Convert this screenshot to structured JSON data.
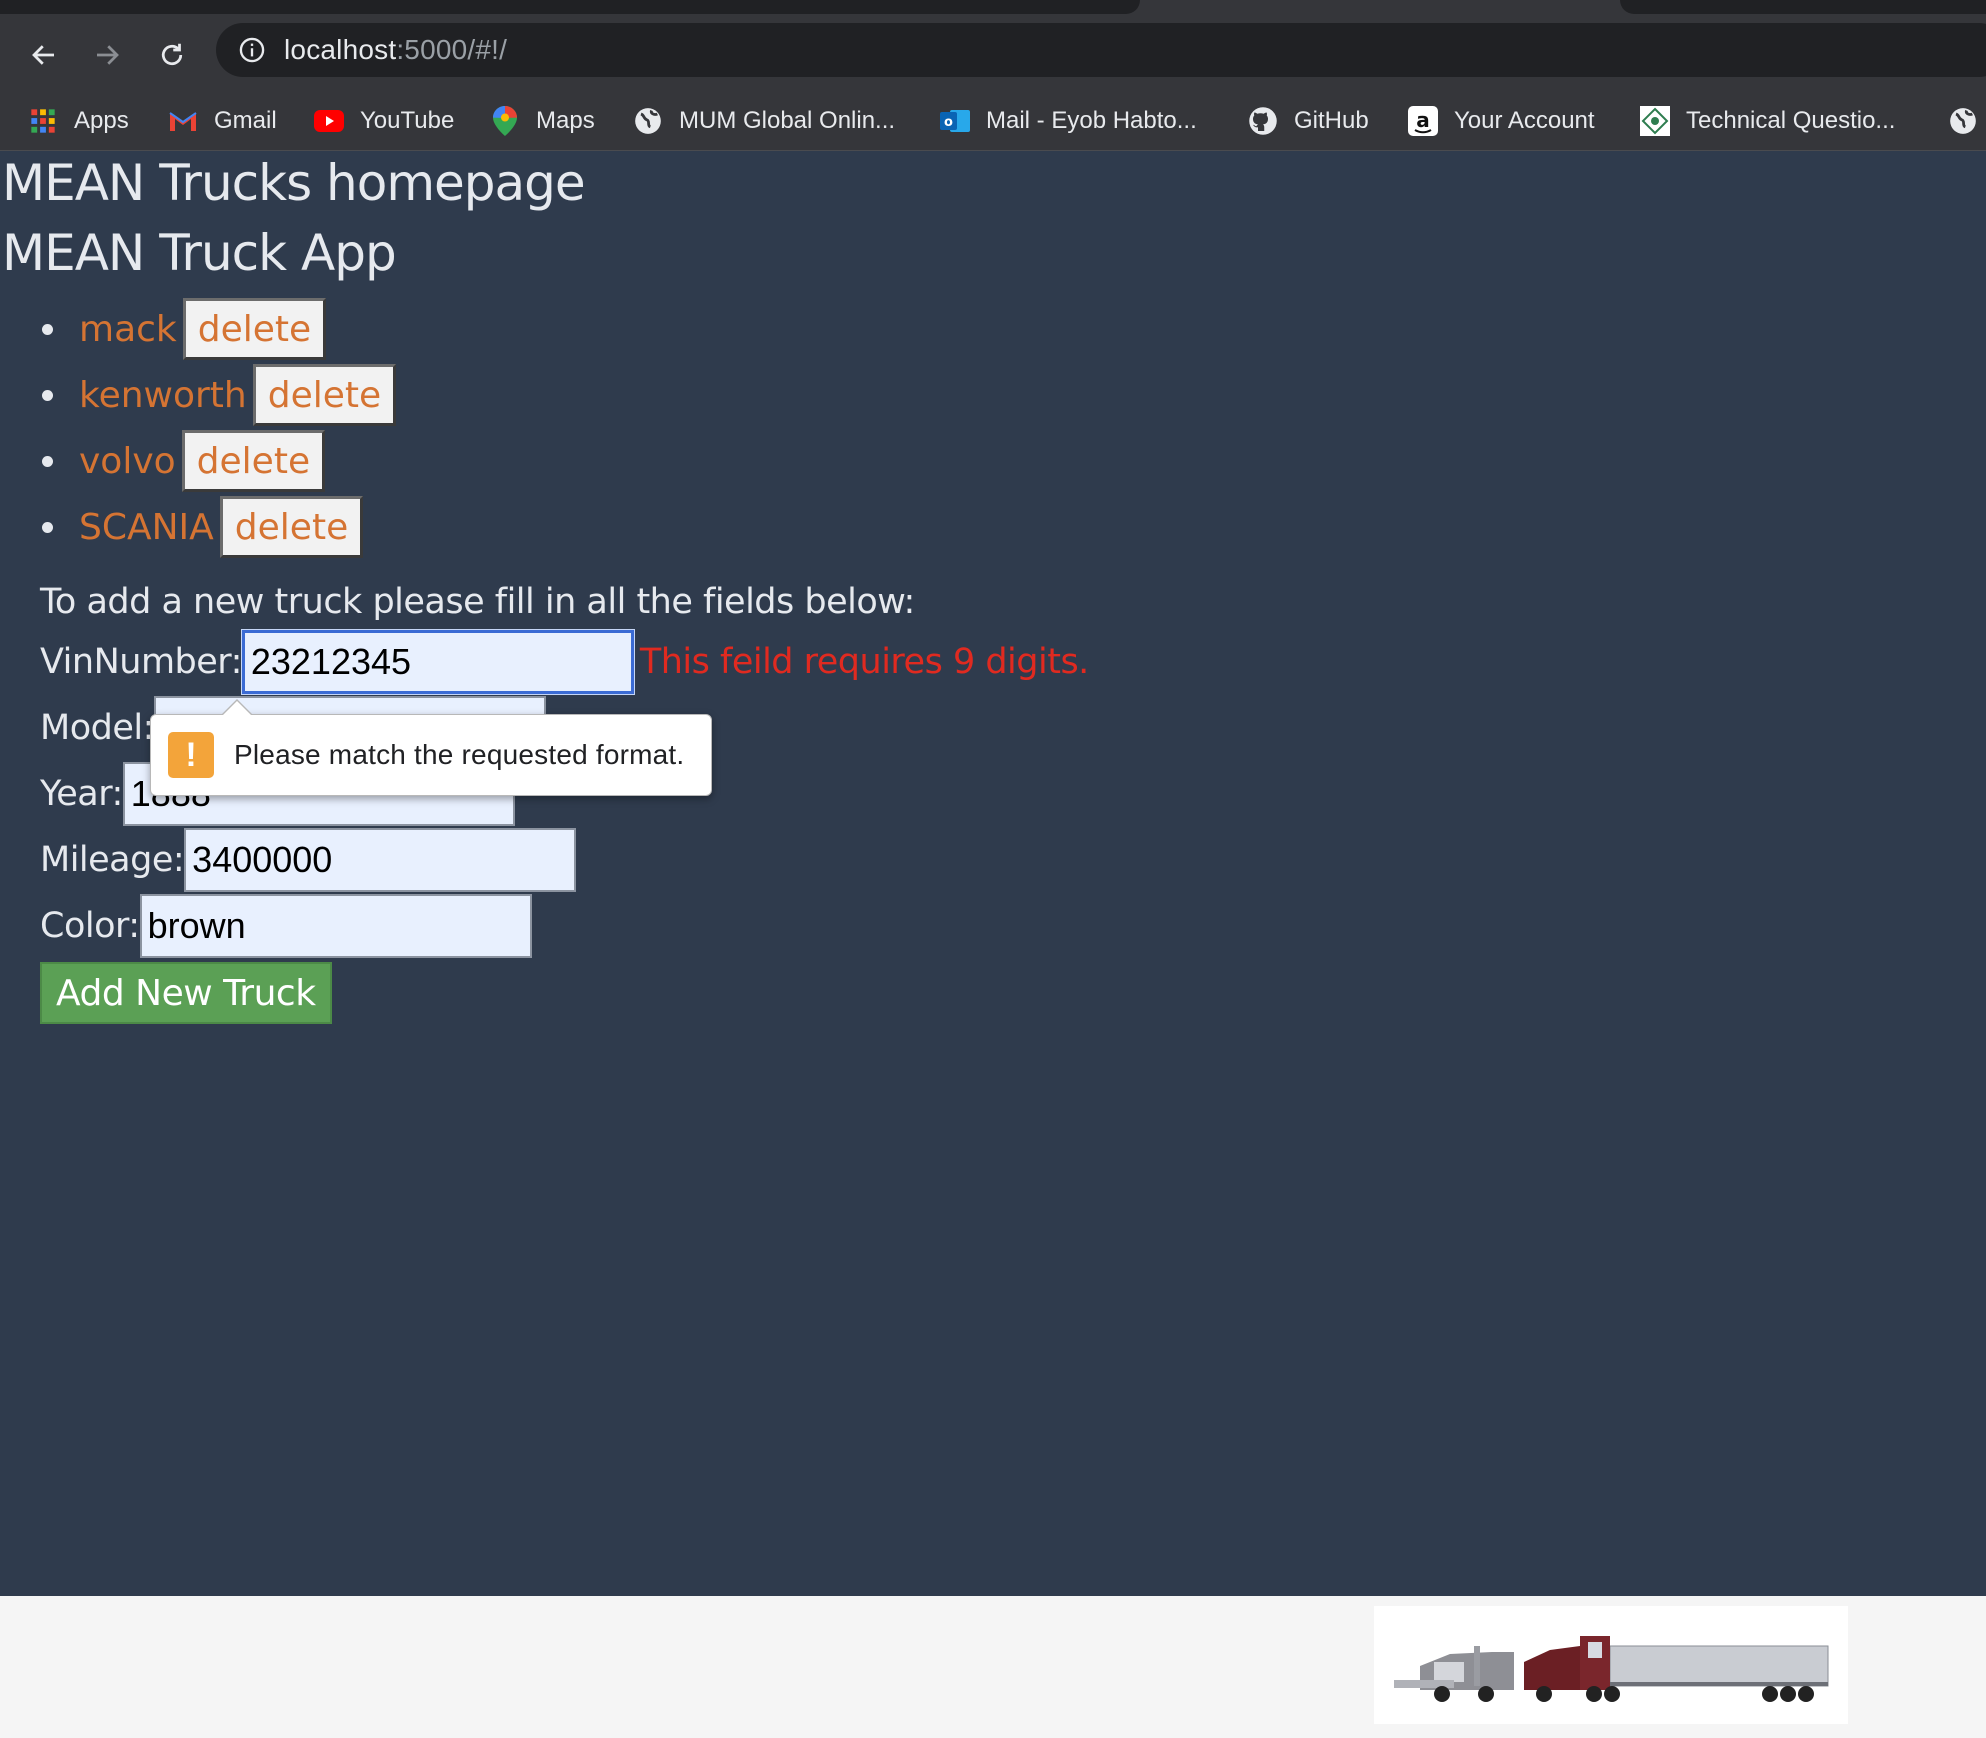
{
  "browser": {
    "url_host": "localhost",
    "url_rest": ":5000/#!/",
    "bookmarks": [
      {
        "label": "Apps",
        "icon": "apps-grid-icon"
      },
      {
        "label": "Gmail",
        "icon": "gmail-icon"
      },
      {
        "label": "YouTube",
        "icon": "youtube-icon"
      },
      {
        "label": "Maps",
        "icon": "maps-pin-icon"
      },
      {
        "label": "MUM Global Onlin...",
        "icon": "globe-icon"
      },
      {
        "label": "Mail - Eyob Habto...",
        "icon": "outlook-icon"
      },
      {
        "label": "GitHub",
        "icon": "github-icon"
      },
      {
        "label": "Your Account",
        "icon": "amazon-icon"
      },
      {
        "label": "Technical Questio...",
        "icon": "tech-icon"
      }
    ]
  },
  "page": {
    "title": "MEAN Trucks homepage",
    "app_title": "MEAN Truck App",
    "trucks": [
      {
        "name": "mack",
        "delete_label": "delete"
      },
      {
        "name": "kenworth",
        "delete_label": "delete"
      },
      {
        "name": "volvo",
        "delete_label": "delete"
      },
      {
        "name": "SCANIA",
        "delete_label": "delete"
      }
    ],
    "form": {
      "instructions": "To add a new truck please fill in all the fields below:",
      "vin_label": "VinNumber:",
      "vin_value": "23212345",
      "vin_error": "This feild requires 9 digits.",
      "model_label": "Model:",
      "model_value": "",
      "year_label": "Year:",
      "year_value": "1888",
      "mileage_label": "Mileage:",
      "mileage_value": "3400000",
      "color_label": "Color:",
      "color_value": "brown",
      "submit_label": "Add New Truck"
    },
    "validation_tooltip": "Please match the requested format."
  },
  "colors": {
    "page_bg": "#2f3b4d",
    "truck_link": "#d57433",
    "error": "#e02a20",
    "submit_bg": "#5ba055"
  }
}
